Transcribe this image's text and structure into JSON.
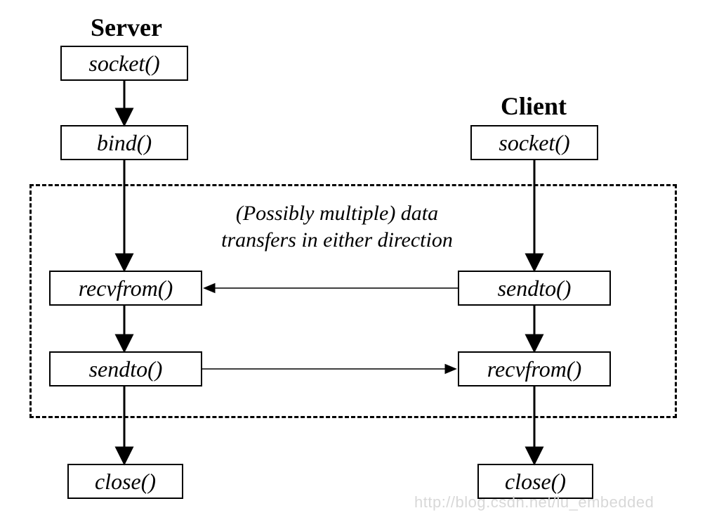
{
  "headings": {
    "server": "Server",
    "client": "Client"
  },
  "server": {
    "socket": "socket()",
    "bind": "bind()",
    "recvfrom": "recvfrom()",
    "sendto": "sendto()",
    "close": "close()"
  },
  "client": {
    "socket": "socket()",
    "sendto": "sendto()",
    "recvfrom": "recvfrom()",
    "close": "close()"
  },
  "annotation": {
    "line1": "(Possibly multiple) data",
    "line2": "transfers in either direction"
  },
  "watermark": "http://blog.csdn.net/lu_embedded"
}
